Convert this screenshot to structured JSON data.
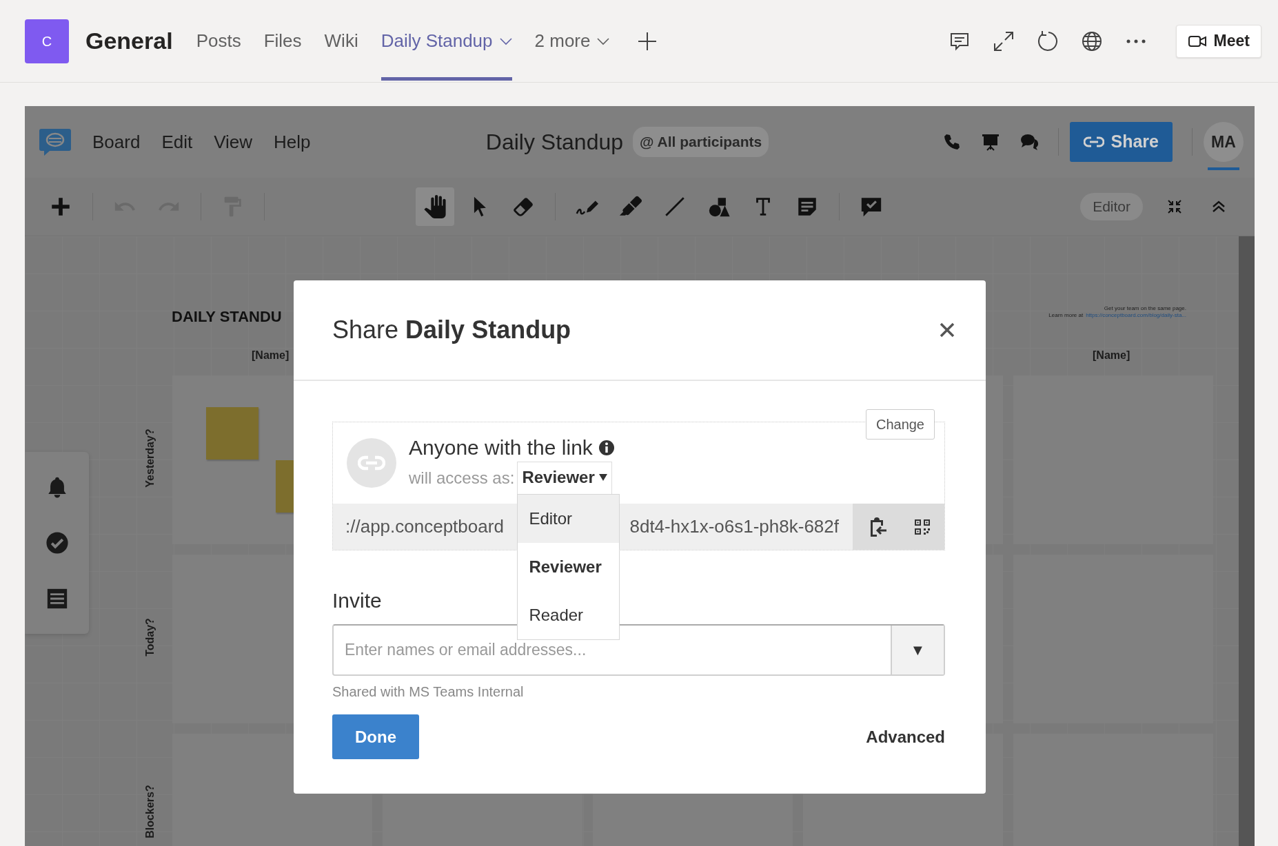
{
  "teams_header": {
    "team_initial": "C",
    "channel": "General",
    "tabs": [
      {
        "label": "Posts",
        "selected": false,
        "caret": false
      },
      {
        "label": "Files",
        "selected": false,
        "caret": false
      },
      {
        "label": "Wiki",
        "selected": false,
        "caret": false
      },
      {
        "label": "Daily Standup",
        "selected": true,
        "caret": true
      },
      {
        "label": "2 more",
        "selected": false,
        "caret": true
      }
    ],
    "meet_button": "Meet"
  },
  "board": {
    "menu": [
      "Board",
      "Edit",
      "View",
      "Help"
    ],
    "title": "Daily Standup",
    "participants": "@ All participants",
    "share_button": "Share",
    "avatar": "MA",
    "toolbar_groups": [
      [
        {
          "kind": "add",
          "selected": false,
          "disabled": false
        }
      ],
      [
        {
          "kind": "undo",
          "selected": false,
          "disabled": true
        },
        {
          "kind": "redo",
          "selected": false,
          "disabled": true
        }
      ],
      [
        {
          "kind": "format",
          "selected": false,
          "disabled": true
        }
      ],
      [
        {
          "kind": "hand",
          "selected": true,
          "disabled": false
        },
        {
          "kind": "select",
          "selected": false,
          "disabled": false
        },
        {
          "kind": "eraser",
          "selected": false,
          "disabled": false
        }
      ],
      [
        {
          "kind": "pen",
          "selected": false,
          "disabled": false
        },
        {
          "kind": "marker",
          "selected": false,
          "disabled": false
        },
        {
          "kind": "line",
          "selected": false,
          "disabled": false
        },
        {
          "kind": "shapes",
          "selected": false,
          "disabled": false
        },
        {
          "kind": "text",
          "selected": false,
          "disabled": false
        },
        {
          "kind": "note",
          "selected": false,
          "disabled": false
        }
      ],
      [
        {
          "kind": "task",
          "selected": false,
          "disabled": false
        }
      ]
    ],
    "mode": "Editor"
  },
  "canvas": {
    "heading": "DAILY STANDU",
    "name_labels": [
      "[Name]",
      "[Name]"
    ],
    "row_labels": [
      "Yesterday?",
      "Today?",
      "Blockers?"
    ],
    "tagline": "Get your team on the same page.",
    "learn_more": "Learn more at",
    "link": "https://conceptboard.com/blog/daily-sta..."
  },
  "dialog": {
    "title": "Share **Daily Standup**",
    "change_button": "Change",
    "link_heading": "Anyone with the link",
    "access_label": "will access as:",
    "access_value": "Reviewer",
    "access_options": [
      {
        "label": "Editor",
        "selected": false,
        "hovered": true
      },
      {
        "label": "Reviewer",
        "selected": true,
        "hovered": false
      },
      {
        "label": "Reader",
        "selected": false,
        "hovered": false
      }
    ],
    "url_start": "://app.conceptboard",
    "url_end": "8dt4-hx1x-o6s1-ph8k-682f",
    "invite_label": "Invite",
    "invite_placeholder": "Enter names or email addresses...",
    "invite_caret": "▼",
    "shared_note": "Shared with MS Teams Internal",
    "done_button": "Done",
    "advanced_link": "Advanced"
  }
}
